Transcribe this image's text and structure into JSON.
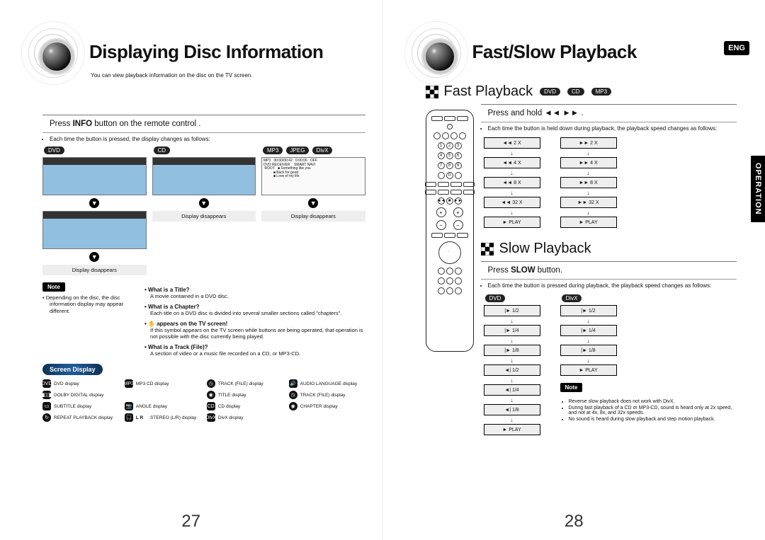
{
  "left_page": {
    "title": "Displaying Disc Information",
    "intro": "You can view playback information on the disc on the TV screen.",
    "band_pre": "Press ",
    "band_bold": "INFO",
    "band_post": " button on the remote control .",
    "subnote": "Each time the button is pressed, the display changes as follows:",
    "formats": {
      "dvd": "DVD",
      "cd": "CD",
      "mp3": "MP3",
      "jpeg": "JPEG",
      "divx": "DivX"
    },
    "display_disappears": "Display disappears",
    "note_label": "Note",
    "note_text_1": "Depending on the disc, the disc",
    "note_text_2": "information display may appear different.",
    "defs": {
      "title_q": "What is a Title?",
      "title_a": "A movie contained in a DVD disc.",
      "chapter_q": "What is a Chapter?",
      "chapter_a": "Each title on a DVD disc is divided into several smaller sections called \"chapters\".",
      "screen_q": "appears on the TV screen!",
      "screen_a": "If this symbol appears on the TV screen while buttons are being operated, that operation is not possible with the disc currently being played.",
      "track_q": "What is a Track (File)?",
      "track_a": "A section of video or a music file recorded on a CD, or MP3-CD."
    },
    "screen_display_label": "Screen Display",
    "legend": {
      "dvd": "DVD display",
      "mp3": "MP3 CD display",
      "trackfile1": "TRACK (FILE) display",
      "audiolang": "AUDIO LANGUAGE display",
      "dolby": "DOLBY DIGITAL display",
      "title": "TITLE display",
      "trackfile2": "TRACK (FILE) display",
      "subtitle": "SUBTITLE display",
      "angle": "ANGLE display",
      "cd": "CD display",
      "chapter": "CHAPTER display",
      "repeat": "REPEAT PLAYBACK display",
      "lr": "STEREO (L/R) display",
      "divx": "DivX display",
      "lr_label": "L R",
      "dvd_label": "DVD",
      "cd_label": "CD",
      "mp3_label": "MP3",
      "divx_label": "DivX"
    },
    "page_num": "27"
  },
  "right_page": {
    "title": "Fast/Slow Playback",
    "eng": "ENG",
    "operation": "OPERATION",
    "fast": {
      "heading": "Fast Playback",
      "badges": [
        "DVD",
        "CD",
        "MP3"
      ],
      "band": "Press and hold ",
      "subnote": "Each time the button is held down during playback, the playback speed changes as follows:",
      "rev": [
        "◄◄ 2 X",
        "◄◄ 4 X",
        "◄◄ 8 X",
        "◄◄ 32 X",
        "► PLAY"
      ],
      "fwd": [
        "►► 2 X",
        "►► 4 X",
        "►► 8 X",
        "►► 32 X",
        "► PLAY"
      ]
    },
    "slow": {
      "heading": "Slow Playback",
      "band_pre": "Press  ",
      "band_bold": "SLOW",
      "band_post": " button.",
      "subnote": "Each time the button is pressed during playback, the playback speed changes as follows:",
      "dvd_label": "DVD",
      "divx_label": "DivX",
      "dvd_flow": [
        "|► 1/2",
        "|► 1/4",
        "|► 1/8",
        "◄| 1/2",
        "◄| 1/4",
        "◄| 1/8",
        "► PLAY"
      ],
      "divx_flow": [
        "|► 1/2",
        "|► 1/4",
        "|► 1/8",
        "► PLAY"
      ],
      "note_label": "Note",
      "notes": [
        "Reverse slow playback does not work with DivX.",
        "During fast playback of a CD or MP3-CD, sound is heard only at 2x speed, and not at 4x, 8x, and 32x speeds.",
        "No sound is heard during slow playback and step motion playback."
      ]
    },
    "page_num": "28"
  }
}
